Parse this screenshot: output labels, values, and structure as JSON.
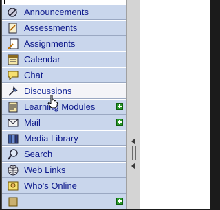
{
  "nav": {
    "items": [
      {
        "label": "Announcements",
        "icon": "announcements-icon",
        "selected": false,
        "addable": false
      },
      {
        "label": "Assessments",
        "icon": "assessments-icon",
        "selected": false,
        "addable": false
      },
      {
        "label": "Assignments",
        "icon": "assignments-icon",
        "selected": false,
        "addable": false
      },
      {
        "label": "Calendar",
        "icon": "calendar-icon",
        "selected": false,
        "addable": false
      },
      {
        "label": "Chat",
        "icon": "chat-icon",
        "selected": false,
        "addable": false
      },
      {
        "label": "Discussions",
        "icon": "discussions-icon",
        "selected": true,
        "addable": false
      },
      {
        "label": "Learning Modules",
        "icon": "learning-modules-icon",
        "selected": false,
        "addable": true
      },
      {
        "label": "Mail",
        "icon": "mail-icon",
        "selected": false,
        "addable": true
      },
      {
        "label": "Media Library",
        "icon": "media-library-icon",
        "selected": false,
        "addable": false
      },
      {
        "label": "Search",
        "icon": "search-icon",
        "selected": false,
        "addable": false
      },
      {
        "label": "Web Links",
        "icon": "web-links-icon",
        "selected": false,
        "addable": false
      },
      {
        "label": "Who's Online",
        "icon": "whos-online-icon",
        "selected": false,
        "addable": false
      },
      {
        "label": "",
        "icon": "unknown-icon",
        "selected": false,
        "addable": true
      }
    ]
  },
  "colors": {
    "nav_bg": "#c9d6ec",
    "nav_text": "#0e1a8c",
    "selected_bg": "#f4f4f8",
    "add_badge": "#2a9a2a"
  }
}
